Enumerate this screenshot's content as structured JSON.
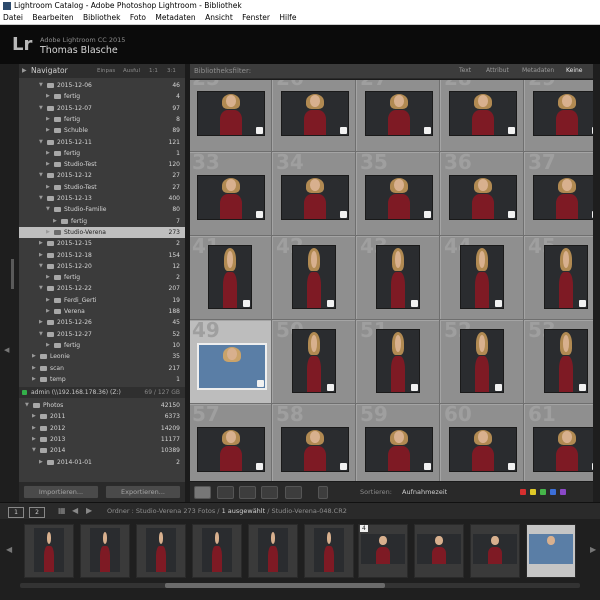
{
  "window": {
    "title": "Lightroom Catalog - Adobe Photoshop Lightroom - Bibliothek"
  },
  "menu": [
    "Datei",
    "Bearbeiten",
    "Bibliothek",
    "Foto",
    "Metadaten",
    "Ansicht",
    "Fenster",
    "Hilfe"
  ],
  "identity": {
    "logo": "Lr",
    "version": "Adobe Lightroom CC 2015",
    "user": "Thomas Blasche"
  },
  "navigator": {
    "title": "Navigator",
    "zoom": [
      "Einpas",
      "Ausful",
      "1:1",
      "3:1"
    ]
  },
  "folders": [
    {
      "label": "2015-12-06",
      "count": "46",
      "level": 2,
      "open": true
    },
    {
      "label": "fertig",
      "count": "4",
      "level": 3
    },
    {
      "label": "2015-12-07",
      "count": "97",
      "level": 2,
      "open": true
    },
    {
      "label": "fertig",
      "count": "8",
      "level": 3
    },
    {
      "label": "Schuble",
      "count": "89",
      "level": 3
    },
    {
      "label": "2015-12-11",
      "count": "121",
      "level": 2,
      "open": true
    },
    {
      "label": "fertig",
      "count": "1",
      "level": 3
    },
    {
      "label": "Studio-Test",
      "count": "120",
      "level": 3
    },
    {
      "label": "2015-12-12",
      "count": "27",
      "level": 2,
      "open": true
    },
    {
      "label": "Studio-Test",
      "count": "27",
      "level": 3
    },
    {
      "label": "2015-12-13",
      "count": "400",
      "level": 2,
      "open": true
    },
    {
      "label": "Studio-Familie",
      "count": "80",
      "level": 3,
      "open": true
    },
    {
      "label": "fertig",
      "count": "7",
      "level": 4
    },
    {
      "label": "Studio-Verena",
      "count": "273",
      "level": 3,
      "selected": true
    },
    {
      "label": "2015-12-15",
      "count": "2",
      "level": 2
    },
    {
      "label": "2015-12-18",
      "count": "154",
      "level": 2
    },
    {
      "label": "2015-12-20",
      "count": "12",
      "level": 2,
      "open": true
    },
    {
      "label": "fertig",
      "count": "2",
      "level": 3
    },
    {
      "label": "2015-12-22",
      "count": "207",
      "level": 2,
      "open": true
    },
    {
      "label": "Ferdi_Gerti",
      "count": "19",
      "level": 3
    },
    {
      "label": "Verena",
      "count": "188",
      "level": 3
    },
    {
      "label": "2015-12-26",
      "count": "45",
      "level": 2
    },
    {
      "label": "2015-12-27",
      "count": "52",
      "level": 2,
      "open": true
    },
    {
      "label": "fertig",
      "count": "10",
      "level": 3
    },
    {
      "label": "Leonie",
      "count": "35",
      "level": 1
    },
    {
      "label": "scan",
      "count": "217",
      "level": 1
    },
    {
      "label": "temp",
      "count": "1",
      "level": 1
    }
  ],
  "volume": {
    "label": "admin (\\\\192.168.178.36) (Z:)",
    "space": "69 / 127 GB"
  },
  "folders2": [
    {
      "label": "Photos",
      "count": "42150",
      "level": 0,
      "open": true
    },
    {
      "label": "2011",
      "count": "6373",
      "level": 1
    },
    {
      "label": "2012",
      "count": "14209",
      "level": 1
    },
    {
      "label": "2013",
      "count": "11177",
      "level": 1
    },
    {
      "label": "2014",
      "count": "10389",
      "level": 1,
      "open": true
    },
    {
      "label": "2014-01-01",
      "count": "2",
      "level": 2
    }
  ],
  "buttons": {
    "import": "Importieren...",
    "export": "Exportieren..."
  },
  "filter": {
    "label": "Bibliotheksfilter:",
    "options": [
      "Text",
      "Attribut",
      "Metadaten",
      "Keine"
    ],
    "active": "Keine"
  },
  "grid_numbers": [
    "25",
    "26",
    "27",
    "28",
    "29",
    "33",
    "34",
    "35",
    "36",
    "37",
    "41",
    "42",
    "43",
    "44",
    "45",
    "49",
    "50",
    "51",
    "52",
    "53",
    "57",
    "58",
    "59",
    "60",
    "61"
  ],
  "toolbar": {
    "sort_label": "Sortieren:",
    "sort_value": "Aufnahmezeit"
  },
  "color_labels": [
    "#d62f2f",
    "#e0c928",
    "#46b54a",
    "#3c6fd8",
    "#8b49c8"
  ],
  "secondary": {
    "monitor1": "1",
    "monitor2": "2",
    "path_prefix": "Ordner : Studio-Verena",
    "count": "273 Fotos",
    "selected": "1 ausgewählt",
    "file": "Studio-Verena-048.CR2"
  },
  "filmstrip_selected_number": "4"
}
